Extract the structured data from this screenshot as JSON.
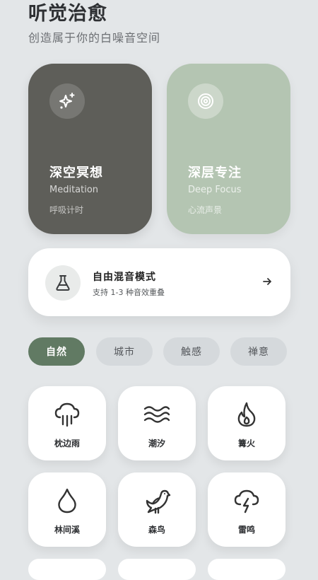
{
  "header": {
    "title": "听觉治愈",
    "subtitle": "创造属于你的白噪音空间"
  },
  "modes": [
    {
      "title": "深空冥想",
      "subtitle": "Meditation",
      "note": "呼吸计时",
      "icon": "sparkles-icon"
    },
    {
      "title": "深层专注",
      "subtitle": "Deep Focus",
      "note": "心流声景",
      "icon": "target-icon"
    }
  ],
  "mix": {
    "title": "自由混音模式",
    "subtitle": "支持 1-3 种音效重叠",
    "icon": "flask-icon",
    "arrow_icon": "arrow-right-icon"
  },
  "tabs": [
    {
      "label": "自然",
      "active": true
    },
    {
      "label": "城市",
      "active": false
    },
    {
      "label": "触感",
      "active": false
    },
    {
      "label": "禅意",
      "active": false
    }
  ],
  "sounds": [
    {
      "label": "枕边雨",
      "icon": "rain-cloud-icon"
    },
    {
      "label": "潮汐",
      "icon": "waves-icon"
    },
    {
      "label": "篝火",
      "icon": "flame-icon"
    },
    {
      "label": "林间溪",
      "icon": "droplet-icon"
    },
    {
      "label": "森鸟",
      "icon": "bird-icon"
    },
    {
      "label": "雷鸣",
      "icon": "thunder-cloud-icon"
    }
  ],
  "colors": {
    "background": "#e3e6e8",
    "meditation_card": "#5e5e59",
    "focus_card": "#b4c5b2",
    "active_tab": "#617a63",
    "inactive_tab": "#d5d9dc"
  }
}
